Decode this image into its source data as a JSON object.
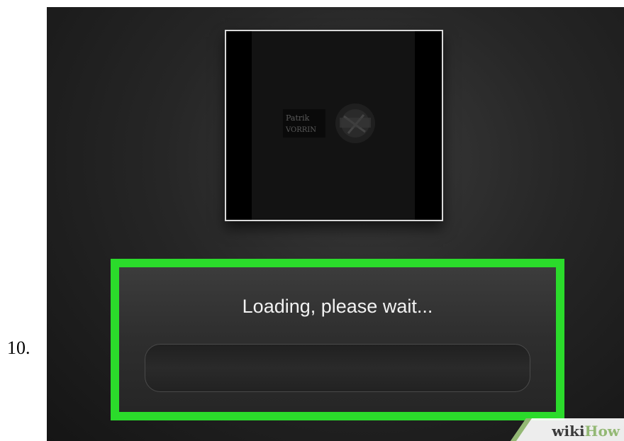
{
  "step": {
    "number": "10."
  },
  "album": {
    "logo_text": [
      "Patrik",
      "VORRIN"
    ]
  },
  "dialog": {
    "message": "Loading, please wait...",
    "progress": 0
  },
  "watermark": {
    "part1": "wiki",
    "part2": "How"
  },
  "colors": {
    "highlight": "#2bdb2b",
    "background": "#262626",
    "text": "#f2f2f2"
  }
}
